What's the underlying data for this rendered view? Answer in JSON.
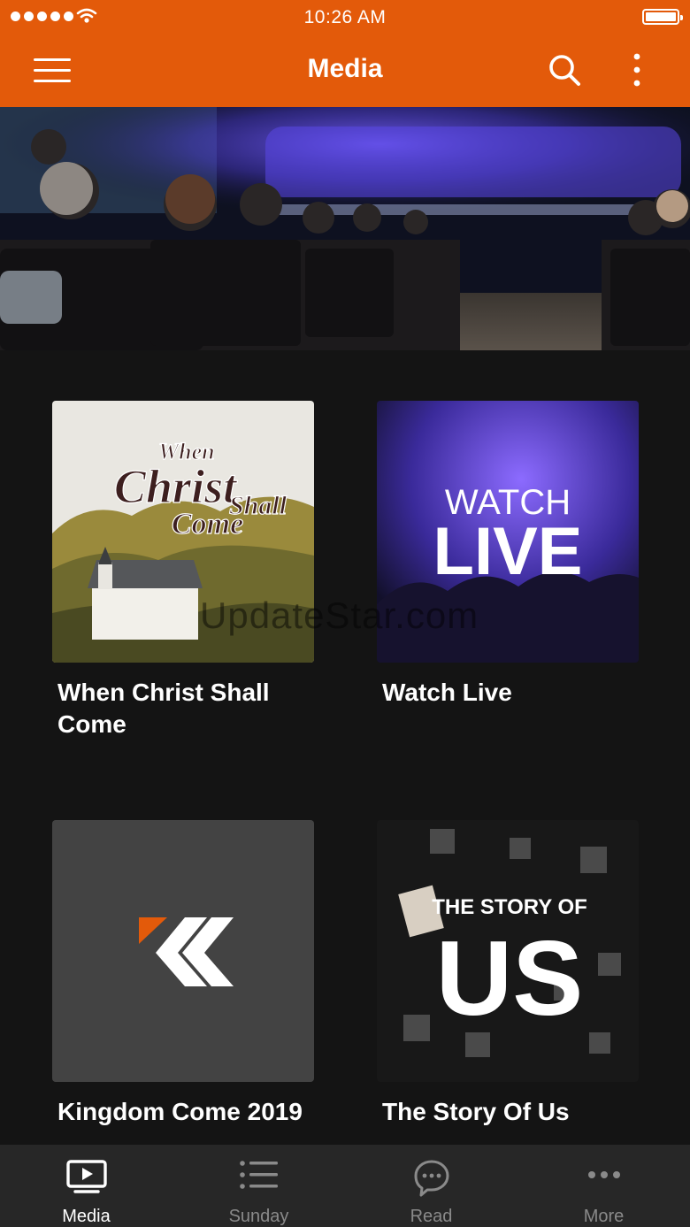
{
  "status_bar": {
    "time": "10:26 AM"
  },
  "header": {
    "title": "Media"
  },
  "cards": [
    {
      "title": "When Christ Shall Come",
      "art_text": [
        "When",
        "Christ",
        "Shall",
        "Come"
      ]
    },
    {
      "title": "Watch Live",
      "art_text": [
        "WATCH",
        "LIVE"
      ]
    },
    {
      "title": "Kingdom Come 2019"
    },
    {
      "title": "The Story Of Us",
      "art_text": [
        "THE STORY OF",
        "US"
      ]
    }
  ],
  "watermark": "UpdateStar.com",
  "tabs": [
    {
      "label": "Media",
      "icon": "tv-play-icon",
      "active": true
    },
    {
      "label": "Sunday",
      "icon": "list-icon",
      "active": false
    },
    {
      "label": "Read",
      "icon": "chat-bubble-icon",
      "active": false
    },
    {
      "label": "More",
      "icon": "more-dots-icon",
      "active": false
    }
  ],
  "colors": {
    "accent": "#E35A0A",
    "background": "#141414",
    "tabbar": "#272727"
  }
}
